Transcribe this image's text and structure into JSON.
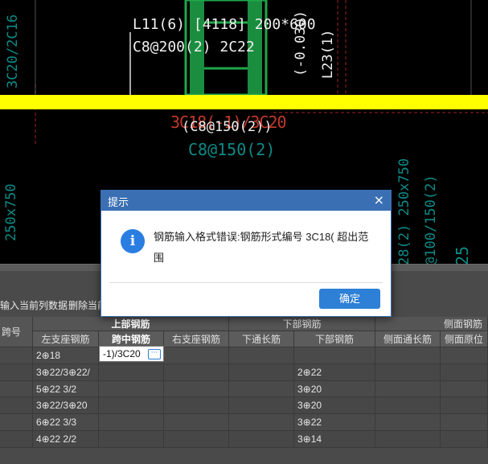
{
  "cad": {
    "beam_name": "L11(6) [4118] 200*600",
    "beam_stirrup": "C8@200(2) 2C22",
    "top_left_vertical": "3C20/2C16",
    "left_vertical_2": "250x750",
    "right_vertical_1": "(-0.030)",
    "right_vertical_2": "L23(1)",
    "red_label": "3C18(-1)/3C20",
    "white_label": "(C8@150(2))",
    "teal_label": "C8@150(2)",
    "right_teal_1": "28(2) 250x750",
    "right_teal_2": "@100/150(2)",
    "right_teal_3": "25",
    "top_teal_right": "(...)"
  },
  "toolbar": {
    "insert_label": "输入当前列数据",
    "delete_label": "删除当前"
  },
  "table": {
    "span_header": "跨号",
    "top_group": "上部钢筋",
    "bottom_group": "下部钢筋",
    "side_group": "侧面钢筋",
    "columns": [
      "左支座钢筋",
      "跨中钢筋",
      "右支座钢筋",
      "下通长筋",
      "下部钢筋",
      "侧面通长筋",
      "侧面原位"
    ],
    "rows": [
      {
        "left": "2⊕18",
        "mid": "",
        "right": "",
        "bottom_through": "",
        "bottom": "",
        "side_through": "",
        "side_in": ""
      },
      {
        "left": "3⊕22/3⊕22/",
        "mid": "",
        "right": "",
        "bottom_through": "",
        "bottom": "2⊕22",
        "side_through": "",
        "side_in": ""
      },
      {
        "left": "5⊕22 3/2",
        "mid": "",
        "right": "",
        "bottom_through": "",
        "bottom": "3⊕20",
        "side_through": "",
        "side_in": ""
      },
      {
        "left": "3⊕22/3⊕20",
        "mid": "",
        "right": "",
        "bottom_through": "",
        "bottom": "3⊕20",
        "side_through": "",
        "side_in": ""
      },
      {
        "left": "6⊕22 3/3",
        "mid": "",
        "right": "",
        "bottom_through": "",
        "bottom": "3⊕22",
        "side_through": "",
        "side_in": ""
      },
      {
        "left": "4⊕22 2/2",
        "mid": "",
        "right": "",
        "bottom_through": "",
        "bottom": "3⊕14",
        "side_through": "",
        "side_in": ""
      }
    ],
    "edit_value": "-1)/3C20"
  },
  "dialog": {
    "title": "提示",
    "message": "钢筋输入格式错误:钢筋形式编号 3C18( 超出范围",
    "ok_label": "确定",
    "icon": "info-icon"
  },
  "colors": {
    "beam_yellow": "#ffff00",
    "green": "#1fa64a",
    "teal": "#0e8a86",
    "accent": "#2e7fd6"
  }
}
